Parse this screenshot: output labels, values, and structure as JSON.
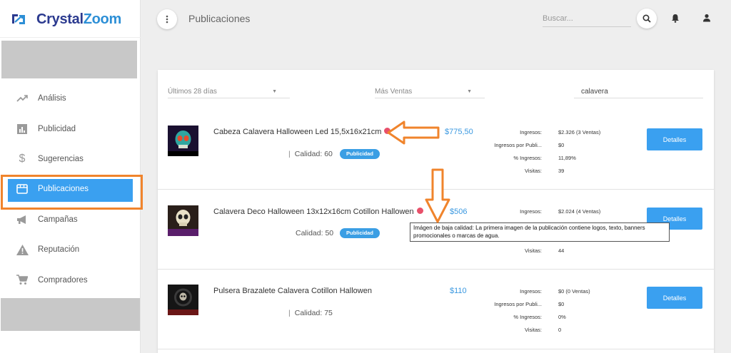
{
  "brand": {
    "part1": "Crystal",
    "part2": "Zoom"
  },
  "sidebar": {
    "items": [
      {
        "label": "Análisis",
        "icon": "trending-up-icon"
      },
      {
        "label": "Publicidad",
        "icon": "bar-chart-icon"
      },
      {
        "label": "Sugerencias",
        "icon": "dollar-icon"
      },
      {
        "label": "Publicaciones",
        "icon": "storefront-icon",
        "active": true
      },
      {
        "label": "Campañas",
        "icon": "megaphone-icon"
      },
      {
        "label": "Reputación",
        "icon": "warning-icon"
      },
      {
        "label": "Compradores",
        "icon": "cart-icon"
      }
    ]
  },
  "header": {
    "title": "Publicaciones",
    "search_placeholder": "Buscar..."
  },
  "filters": {
    "period": "Últimos 28 días",
    "sort": "Más Ventas",
    "query": "calavera"
  },
  "products": [
    {
      "title": "Cabeza Calavera Halloween Led 15,5x16x21cm",
      "price": "$775,50",
      "quality_label": "Calidad:",
      "quality_value": "60",
      "badge": "Publicidad",
      "stats": [
        {
          "label": "Ingresos:",
          "value": "$2.326 (3 Ventas)"
        },
        {
          "label": "Ingresos por Publi...",
          "value": "$0"
        },
        {
          "label": "% Ingresos:",
          "value": "11,89%"
        },
        {
          "label": "Visitas:",
          "value": "39"
        }
      ],
      "button": "Detalles",
      "warning": true,
      "thumb_caption": "Calavera Halloween Led"
    },
    {
      "title": "Calavera Deco Halloween 13x12x16cm Cotillon Hallowen",
      "price": "$506",
      "quality_label": "Calidad:",
      "quality_value": "50",
      "badge": "Publicidad",
      "stats": [
        {
          "label": "Ingresos:",
          "value": "$2.024 (4 Ventas)"
        },
        {
          "label": "Visitas:",
          "value": "44"
        }
      ],
      "button": "Detalles",
      "warning": true,
      "thumb_caption": "Calavera Deco"
    },
    {
      "title": "Pulsera Brazalete Calavera Cotillon Hallowen",
      "price": "$110",
      "quality_label": "Calidad:",
      "quality_value": "75",
      "stats": [
        {
          "label": "Ingresos:",
          "value": "$0 (0 Ventas)"
        },
        {
          "label": "Ingresos por Publi...",
          "value": "$0"
        },
        {
          "label": "% Ingresos:",
          "value": "0%"
        },
        {
          "label": "Visitas:",
          "value": "0"
        }
      ],
      "button": "Detalles",
      "warning": false,
      "thumb_caption": "Pulsera Brazalete"
    }
  ],
  "tooltip": "Imágen de baja calidad: La primera imagen de la publicación contiene logos, texto, banners promocionales o marcas de agua.",
  "colors": {
    "accent": "#3aa0f0",
    "annotation": "#f0842c",
    "warning": "#e8506a",
    "price": "#3a98e0"
  }
}
